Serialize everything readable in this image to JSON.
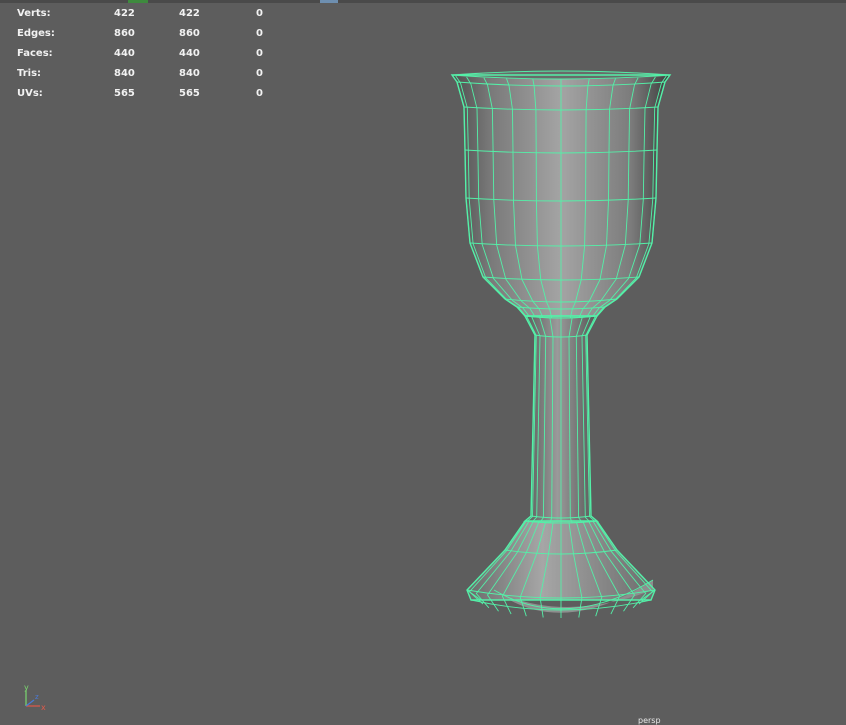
{
  "hud": {
    "rows": [
      {
        "label": "Verts:",
        "total": "422",
        "selected": "422",
        "highlighted": "0"
      },
      {
        "label": "Edges:",
        "total": "860",
        "selected": "860",
        "highlighted": "0"
      },
      {
        "label": "Faces:",
        "total": "440",
        "selected": "440",
        "highlighted": "0"
      },
      {
        "label": "Tris:",
        "total": "840",
        "selected": "840",
        "highlighted": "0"
      },
      {
        "label": "UVs:",
        "total": "565",
        "selected": "565",
        "highlighted": "0"
      }
    ]
  },
  "axis": {
    "y_label": "y",
    "x_label": "x",
    "z_label": "z"
  },
  "camera_label": "persp",
  "colors": {
    "background": "#5d5d5d",
    "wireframe": "#54f0a8",
    "hud_text": "#f2f2f2",
    "axis_y": "#7bd86f",
    "axis_x": "#e05a4a",
    "axis_z": "#4a7ad8"
  }
}
